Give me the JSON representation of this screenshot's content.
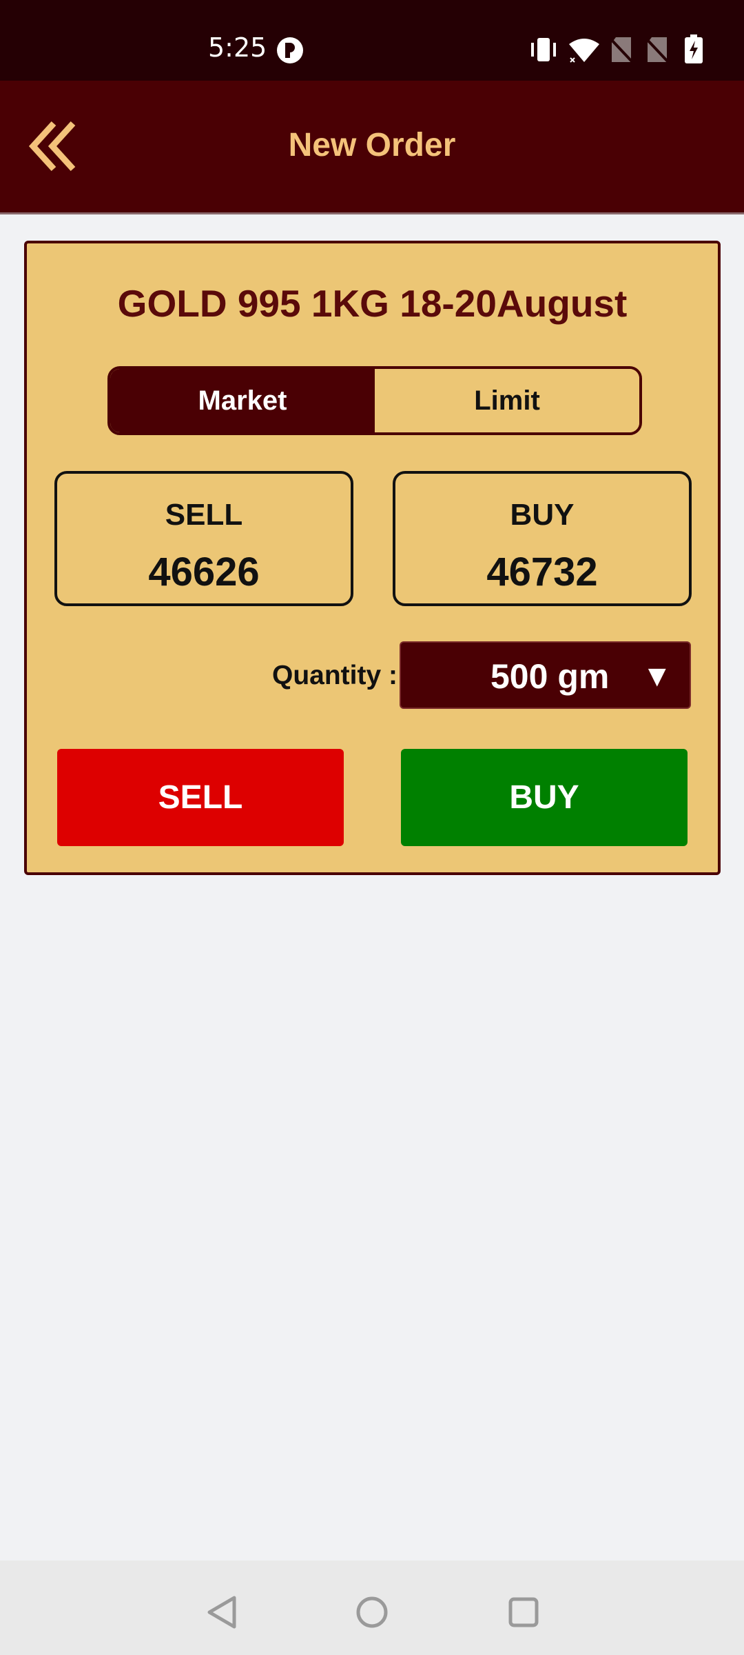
{
  "status_bar": {
    "time": "5:25",
    "icons": [
      "app-notification-icon",
      "vibrate-icon",
      "wifi-icon",
      "no-sim-icon",
      "no-sim-icon",
      "battery-charging-icon"
    ]
  },
  "app_bar": {
    "title": "New Order",
    "back_icon": "double-chevron-left-icon"
  },
  "order_card": {
    "title": "GOLD 995 1KG 18-20August",
    "order_types": [
      "Market",
      "Limit"
    ],
    "selected_order_type": "Market",
    "sell_price": {
      "label": "SELL",
      "value": "46626"
    },
    "buy_price": {
      "label": "BUY",
      "value": "46732"
    },
    "quantity": {
      "label": "Quantity :",
      "value": "500 gm",
      "arrow": "▼"
    },
    "sell_button": "SELL",
    "buy_button": "BUY"
  },
  "colors": {
    "status_bar": "#250004",
    "app_bar": "#4a0004",
    "accent_text": "#f4c27a",
    "card_background": "#ecc675",
    "sell_red": "#dd0000",
    "buy_green": "#008000"
  },
  "nav_bar": {
    "icons": [
      "back-triangle-icon",
      "home-circle-icon",
      "recents-square-icon"
    ]
  }
}
